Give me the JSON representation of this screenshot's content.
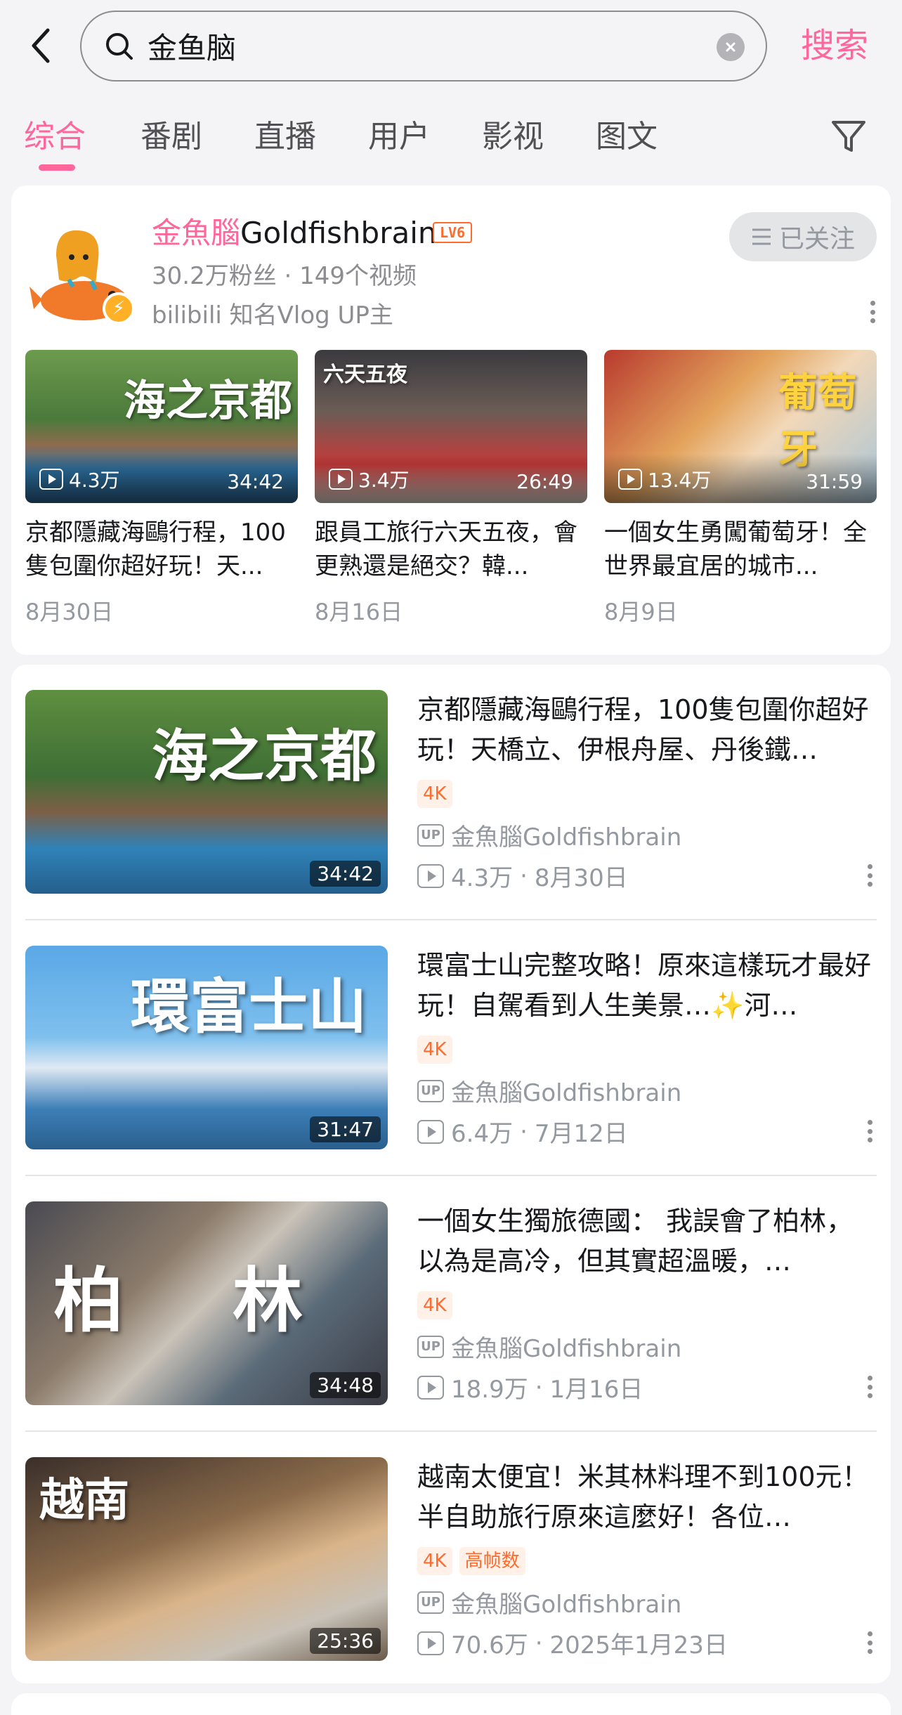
{
  "header": {
    "search_value": "金鱼脑",
    "search_button": "搜索"
  },
  "tabs": [
    {
      "label": "综合",
      "active": true
    },
    {
      "label": "番剧"
    },
    {
      "label": "直播"
    },
    {
      "label": "用户"
    },
    {
      "label": "影视"
    },
    {
      "label": "图文"
    }
  ],
  "user": {
    "name_highlight": "金魚腦",
    "name_rest": "Goldfishbrain",
    "level_badge": "LV6",
    "stats": "30.2万粉丝 · 149个视频",
    "description": "bilibili 知名Vlog UP主",
    "follow_label": "已关注",
    "videos": [
      {
        "views": "4.3万",
        "duration": "34:42",
        "title": "京都隱藏海鷗行程，100隻包圍你超好玩！天...",
        "date": "8月30日",
        "thumb_text": "海之京都"
      },
      {
        "views": "3.4万",
        "duration": "26:49",
        "title": "跟員工旅行六天五夜，會更熟還是絕交？韓...",
        "date": "8月16日",
        "thumb_text": "六天五夜"
      },
      {
        "views": "13.4万",
        "duration": "31:59",
        "title": "一個女生勇闖葡萄牙！全世界最宜居的城市...",
        "date": "8月9日",
        "thumb_text": "葡萄牙"
      }
    ]
  },
  "videos": [
    {
      "title": "京都隱藏海鷗行程，100隻包圍你超好玩！天橋立、伊根舟屋、丹後鐵…",
      "tags": [
        "4K"
      ],
      "up": "金魚腦Goldfishbrain",
      "views": "4.3万",
      "date": "8月30日",
      "duration": "34:42",
      "thumb_text": "海之京都"
    },
    {
      "title": "環富士山完整攻略！原來這樣玩才最好玩！自駕看到人生美景…✨河…",
      "tags": [
        "4K"
      ],
      "up": "金魚腦Goldfishbrain",
      "views": "6.4万",
      "date": "7月12日",
      "duration": "31:47",
      "thumb_text": "環富士山"
    },
    {
      "title": "一個女生獨旅德國： 我誤會了柏林，以為是高冷，但其實超溫暖，…",
      "tags": [
        "4K"
      ],
      "up": "金魚腦Goldfishbrain",
      "views": "18.9万",
      "date": "1月16日",
      "duration": "34:48",
      "thumb_text": "柏 林"
    },
    {
      "title": "越南太便宜！米其林料理不到100元！半自助旅行原來這麼好！各位…",
      "tags": [
        "4K",
        "高帧数"
      ],
      "up": "金魚腦Goldfishbrain",
      "views": "70.6万",
      "date": "2025年1月23日",
      "duration": "25:36",
      "thumb_text": "越南"
    }
  ],
  "colors": {
    "accent": "#ff6699",
    "tag": "#ff6b2c"
  }
}
